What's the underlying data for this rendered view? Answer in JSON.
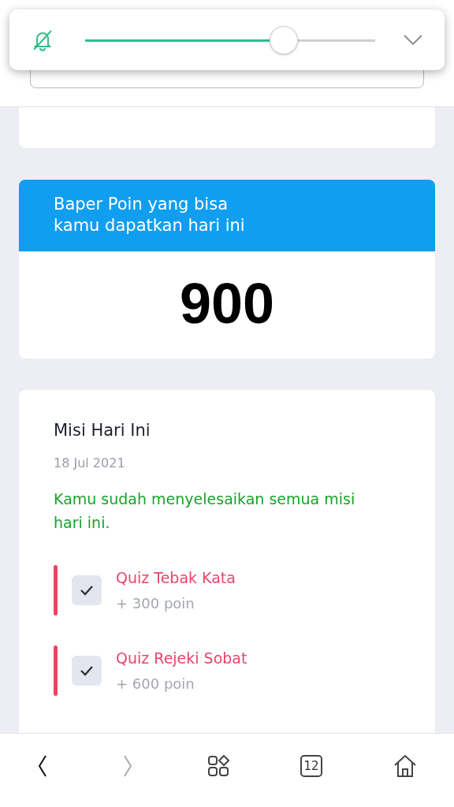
{
  "volume_panel": {
    "muted": true,
    "level": 0.685
  },
  "points_card": {
    "title": "Baper Poin yang bisa kamu dapatkan hari ini",
    "value": "900"
  },
  "missions_card": {
    "title": "Misi Hari Ini",
    "date": "18 Jul 2021",
    "message": "Kamu sudah menyelesaikan semua misi hari ini.",
    "missions": [
      {
        "name": "Quiz Tebak Kata",
        "points": "+ 300 poin",
        "checked": true
      },
      {
        "name": "Quiz Rejeki Sobat",
        "points": "+ 600 poin",
        "checked": true
      }
    ]
  },
  "browser_nav": {
    "back_disabled": false,
    "forward_disabled": true,
    "tab_count": "12"
  }
}
